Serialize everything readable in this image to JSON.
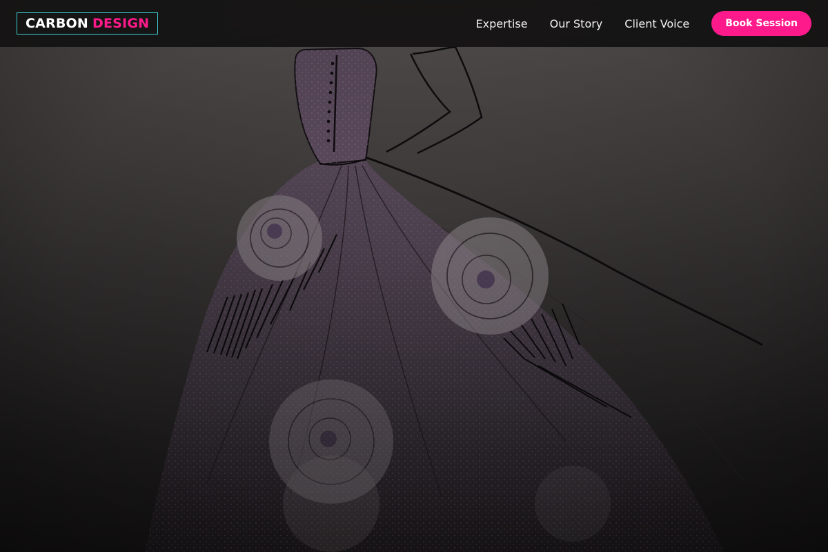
{
  "brand": {
    "name_primary": "CARBON",
    "name_accent": "DESIGN"
  },
  "nav": {
    "links": [
      {
        "label": "Expertise"
      },
      {
        "label": "Our Story"
      },
      {
        "label": "Client Voice"
      }
    ],
    "cta_label": "Book Session"
  },
  "colors": {
    "accent": "#ff1a8c",
    "logo_border": "#3fd0d4",
    "navbar_bg": "#141313",
    "hero_top": "#5b5756",
    "hero_bottom": "#161414"
  },
  "icons": {
    "hero_image": "ball-gown-sketch-illustration"
  }
}
